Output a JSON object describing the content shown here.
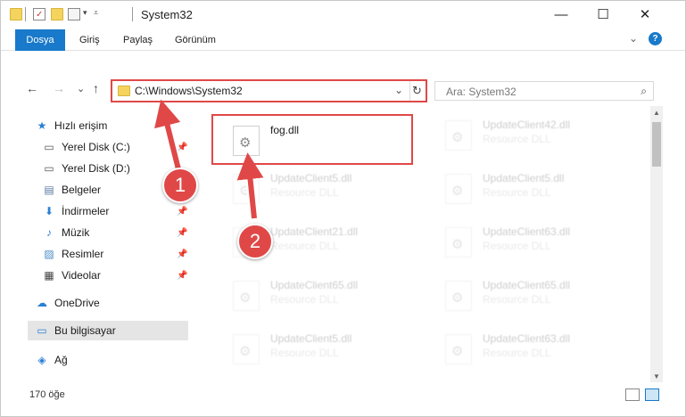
{
  "window": {
    "title": "System32",
    "minimize": "—",
    "maximize": "☐",
    "close": "✕"
  },
  "ribbon": {
    "tabs": [
      "Dosya",
      "Giriş",
      "Paylaş",
      "Görünüm"
    ],
    "expand": "⌄",
    "help": "?"
  },
  "nav": {
    "back": "←",
    "forward": "→",
    "recent": "⌄",
    "up": "↑",
    "address": "C:\\Windows\\System32",
    "refresh": "↻",
    "search_placeholder": "Ara: System32",
    "search_icon": "⌕"
  },
  "sidebar": {
    "items": [
      {
        "label": "Hızlı erişim",
        "icon": "★",
        "pinned": false
      },
      {
        "label": "Yerel Disk (C:)",
        "icon": "▭",
        "pinned": true
      },
      {
        "label": "Yerel Disk (D:)",
        "icon": "▭",
        "pinned": true
      },
      {
        "label": "Belgeler",
        "icon": "▤",
        "pinned": true
      },
      {
        "label": "İndirmeler",
        "icon": "⬇",
        "pinned": true
      },
      {
        "label": "Müzik",
        "icon": "♪",
        "pinned": true
      },
      {
        "label": "Resimler",
        "icon": "▨",
        "pinned": true
      },
      {
        "label": "Videolar",
        "icon": "▦",
        "pinned": true
      },
      {
        "label": "OneDrive",
        "icon": "☁",
        "pinned": false
      },
      {
        "label": "Bu bilgisayar",
        "icon": "▭",
        "pinned": false
      },
      {
        "label": "Ağ",
        "icon": "◈",
        "pinned": false
      }
    ],
    "pin_glyph": "📌"
  },
  "files": {
    "highlighted": {
      "name": "fog.dll",
      "desc": ""
    },
    "left_column": [
      {
        "name": "UpdateClient5.dll",
        "desc": "Resource DLL"
      },
      {
        "name": "UpdateClient21.dll",
        "desc": "Resource DLL"
      },
      {
        "name": "UpdateClient65.dll",
        "desc": "Resource DLL"
      },
      {
        "name": "UpdateClient5.dll",
        "desc": "Resource DLL"
      }
    ],
    "right_column": [
      {
        "name": "UpdateClient42.dll",
        "desc": "Resource DLL"
      },
      {
        "name": "UpdateClient5.dll",
        "desc": "Resource DLL"
      },
      {
        "name": "UpdateClient63.dll",
        "desc": "Resource DLL"
      },
      {
        "name": "UpdateClient65.dll",
        "desc": "Resource DLL"
      },
      {
        "name": "UpdateClient63.dll",
        "desc": "Resource DLL"
      }
    ]
  },
  "status": {
    "count": "170 öğe"
  },
  "annotations": {
    "step1": "1",
    "step2": "2",
    "color": "#e04848"
  },
  "colors": {
    "accent": "#1979ca",
    "highlight": "#e04848"
  }
}
